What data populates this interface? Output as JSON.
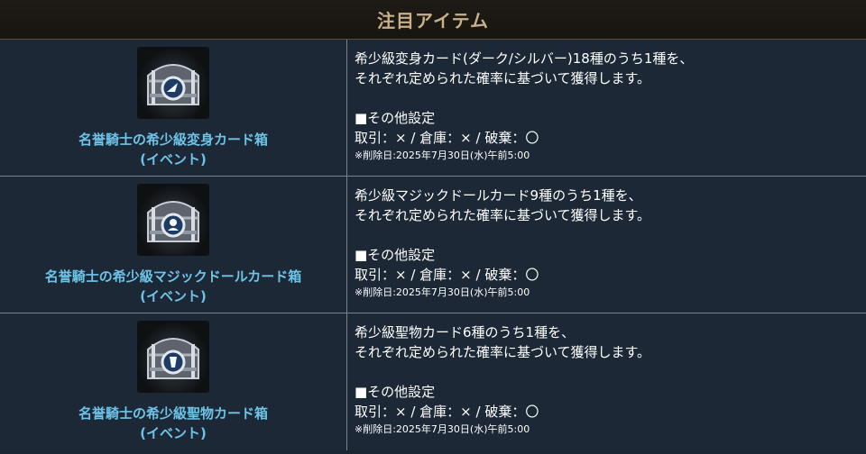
{
  "header": {
    "title": "注目アイテム"
  },
  "items": [
    {
      "name_line1": "名誉騎士の希少級変身カード箱",
      "name_line2": "(イベント)",
      "desc_line1": "希少級変身カード(ダーク/シルバー)18種のうち1種を、",
      "desc_line2": "それぞれ定められた確率に基づいて獲得します。",
      "settings_title": "■その他設定",
      "settings": "取引：× / 倉庫：× / 破棄：〇",
      "note": "※削除日:2025年7月30日(水)午前5:00",
      "icon": "treasure-chest-icon"
    },
    {
      "name_line1": "名誉騎士の希少級マジックドールカード箱",
      "name_line2": "(イベント)",
      "desc_line1": "希少級マジックドールカード9種のうち1種を、",
      "desc_line2": "それぞれ定められた確率に基づいて獲得します。",
      "settings_title": "■その他設定",
      "settings": "取引：× / 倉庫：× / 破棄：〇",
      "note": "※削除日:2025年7月30日(水)午前5:00",
      "icon": "treasure-chest-icon"
    },
    {
      "name_line1": "名誉騎士の希少級聖物カード箱",
      "name_line2": "(イベント)",
      "desc_line1": "希少級聖物カード6種のうち1種を、",
      "desc_line2": "それぞれ定められた確率に基づいて獲得します。",
      "settings_title": "■その他設定",
      "settings": "取引：× / 倉庫：× / 破棄：〇",
      "note": "※削除日:2025年7月30日(水)午前5:00",
      "icon": "treasure-chest-icon"
    }
  ],
  "colors": {
    "header_text": "#c7b08a",
    "item_name": "#6ec3e8",
    "background": "#1c2836"
  }
}
